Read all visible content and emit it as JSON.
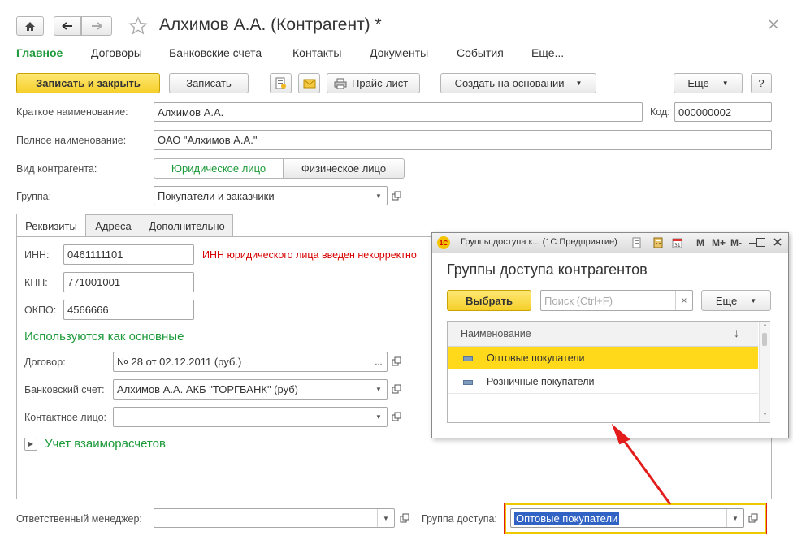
{
  "window": {
    "title": "Алхимов А.А. (Контрагент) *"
  },
  "nav_tabs": [
    "Главное",
    "Договоры",
    "Банковские счета",
    "Контакты",
    "Документы",
    "События",
    "Еще..."
  ],
  "toolbar": {
    "save_close": "Записать и закрыть",
    "save": "Записать",
    "price_list": "Прайс-лист",
    "create_based": "Создать на основании",
    "more": "Еще",
    "help": "?"
  },
  "form": {
    "short_name_label": "Краткое наименование:",
    "short_name_value": "Алхимов А.А.",
    "code_label": "Код:",
    "code_value": "000000002",
    "full_name_label": "Полное наименование:",
    "full_name_value": "ОАО \"Алхимов А.А.\"",
    "kind_label": "Вид контрагента:",
    "kind_legal": "Юридическое лицо",
    "kind_physical": "Физическое лицо",
    "group_label": "Группа:",
    "group_value": "Покупатели и заказчики"
  },
  "inner_tabs": [
    "Реквизиты",
    "Адреса",
    "Дополнительно"
  ],
  "requisites": {
    "inn_label": "ИНН:",
    "inn_value": "0461111101",
    "inn_error": "ИНН юридического лица введен некорректно",
    "kpp_label": "КПП:",
    "kpp_value": "771001001",
    "okpo_label": "ОКПО:",
    "okpo_value": "4566666",
    "section_title": "Используются как основные",
    "contract_label": "Договор:",
    "contract_value": "№ 28 от 02.12.2011 (руб.)",
    "bank_label": "Банковский счет:",
    "bank_value": "Алхимов А.А. АКБ \"ТОРГБАНК\" (руб)",
    "contact_label": "Контактное лицо:",
    "contact_value": "",
    "settlements": "Учет взаиморасчетов"
  },
  "bottom": {
    "manager_label": "Ответственный менеджер:",
    "manager_value": "",
    "access_label": "Группа доступа:",
    "access_value": "Оптовые покупатели"
  },
  "popup": {
    "window_title": "Группы доступа к... (1С:Предприятие)",
    "heading": "Группы доступа контрагентов",
    "select_button": "Выбрать",
    "search_placeholder": "Поиск (Ctrl+F)",
    "more": "Еще",
    "column_header": "Наименование",
    "rows": [
      "Оптовые покупатели",
      "Розничные покупатели"
    ],
    "tb_m": "M",
    "tb_mplus": "M+",
    "tb_mminus": "M-"
  },
  "colors": {
    "accent_green": "#1d9a3a",
    "error_red": "#d60000",
    "highlight_yellow": "#ffd91a",
    "annotation_red": "#e31c1c"
  }
}
